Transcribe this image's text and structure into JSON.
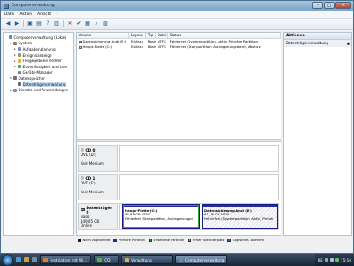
{
  "window": {
    "title": "Computerverwaltung"
  },
  "menu": [
    "Datei",
    "Aktion",
    "Ansicht",
    "?"
  ],
  "tree": [
    {
      "label": "Computerverwaltung (Lokal)",
      "indent": 0,
      "expander": "",
      "icon": "computer-icon",
      "color": "#6a8bb0"
    },
    {
      "label": "System",
      "indent": 1,
      "expander": "▾",
      "icon": "tools-icon",
      "color": "#8a7a60"
    },
    {
      "label": "Aufgabenplanung",
      "indent": 2,
      "expander": "▸",
      "icon": "clock-icon",
      "color": "#6a8fc0"
    },
    {
      "label": "Ereignisanzeige",
      "indent": 2,
      "expander": "▸",
      "icon": "event-icon",
      "color": "#b09050"
    },
    {
      "label": "Freigegebene Ordner",
      "indent": 2,
      "expander": "▸",
      "icon": "folder-icon",
      "color": "#e0b040"
    },
    {
      "label": "Zuverlässigkeit und Leis",
      "indent": 2,
      "expander": "▸",
      "icon": "performance-icon",
      "color": "#50a050"
    },
    {
      "label": "Geräte-Manager",
      "indent": 2,
      "expander": "",
      "icon": "device-icon",
      "color": "#7080a0"
    },
    {
      "label": "Datenspeicher",
      "indent": 1,
      "expander": "▾",
      "icon": "storage-icon",
      "color": "#707070"
    },
    {
      "label": "Datenträgerverwaltung",
      "indent": 2,
      "expander": "",
      "icon": "disk-icon",
      "color": "#5a6a7a",
      "selected": true
    },
    {
      "label": "Dienste und Anwendungen",
      "indent": 1,
      "expander": "▸",
      "icon": "services-icon",
      "color": "#8090a8"
    }
  ],
  "volumes": {
    "headers": [
      "Volume",
      "Layout",
      "Typ",
      "Dateisystem",
      "Status"
    ],
    "rows": [
      [
        "Datensicherung Andi (E:)",
        "Einfach",
        "Basis",
        "NTFS",
        "Fehlerfrei (Systempartition, Aktiv, Primäre Partition)"
      ],
      [
        "Haupt-Platte (C:)",
        "Einfach",
        "Basis",
        "NTFS",
        "Fehlerfrei (Startpartition, Auslagerungsdatei, Absturz"
      ]
    ]
  },
  "disks": [
    {
      "name": "CD 0",
      "lines": [
        "DVD (D:)",
        "",
        "Kein Medium"
      ],
      "kind": "cd"
    },
    {
      "name": "CD 1",
      "lines": [
        "DVD (F:)",
        "",
        "Kein Medium"
      ],
      "kind": "cd"
    },
    {
      "name": "Datenträger 0",
      "lines": [
        "Basis",
        "149,05 GB",
        "Online"
      ],
      "kind": "hdd"
    }
  ],
  "partitions": [
    {
      "title": "Haupt-Platte (C:)",
      "size": "87,88 GB NTFS",
      "status": "Fehlerfrei (Startpartition, Auslagerungsd"
    },
    {
      "title": "Datensicherung Andi (E:)",
      "size": "61,16 GB NTFS",
      "status": "Fehlerfrei (Systempartition, Aktiv, Primär"
    }
  ],
  "legend": [
    {
      "label": "Nicht zugeordnet",
      "color": "#000000"
    },
    {
      "label": "Primäre Partition",
      "color": "#1c2ea0"
    },
    {
      "label": "Erweiterte Partition",
      "color": "#2a9a2a"
    },
    {
      "label": "Freier Speicherplatz",
      "color": "#60c060"
    },
    {
      "label": "Logisches Laufwerk",
      "color": "#3a5ad0"
    }
  ],
  "actions": {
    "header": "Aktionen",
    "item": "Datenträgerverwaltung",
    "item_arrow": "▲"
  },
  "taskbar": {
    "tasks": [
      {
        "label": "Festplatten mit Wi...",
        "color": "#e07a30"
      },
      {
        "label": "ICQ",
        "color": "#60b040"
      },
      {
        "label": "Verwaltung",
        "color": "#e0b040"
      },
      {
        "label": "Computerverwaltung",
        "color": "#6a8bb0",
        "active": true
      }
    ],
    "tray_lang": "DE",
    "clock": "15:16"
  }
}
